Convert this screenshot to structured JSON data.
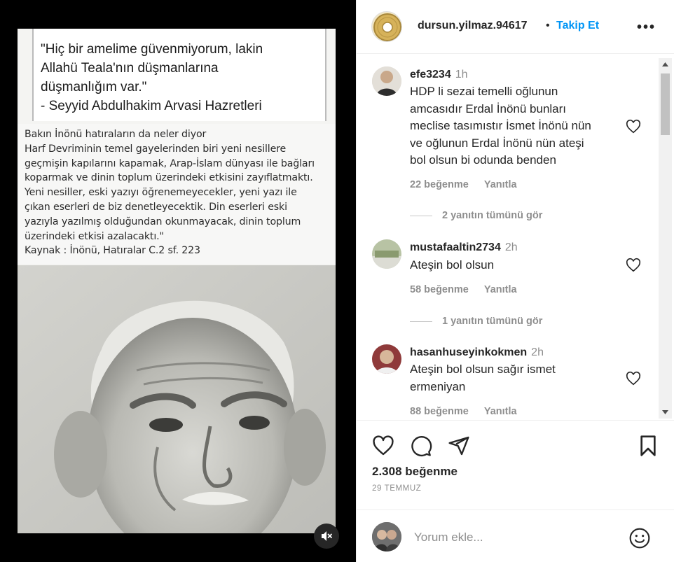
{
  "post": {
    "quote_lines": [
      "\"Hiç bir amelime güvenmiyorum, lakin",
      "Allahü Teala'nın düşmanlarına",
      "düşmanlığım var.\"",
      "- Seyyid Abdulhakim Arvasi Hazretleri"
    ],
    "text_lines": [
      "Bakın  İnönü hatıraların da neler diyor",
      "Harf Devriminin temel gayelerinden biri yeni nesillere",
      "geçmişin kapılarını kapamak, Arap-İslam dünyası ile bağları",
      "koparmak ve dinin toplum üzerindeki etkisini zayıflatmaktı.",
      "Yeni nesiller, eski yazıyı öğrenemeyecekler, yeni yazı ile",
      "çıkan eserleri de biz denetleyecektik. Din eserleri eski",
      "yazıyla yazılmış olduğundan okunmayacak, dinin toplum",
      "üzerindeki etkisi azalacaktı.\"",
      "Kaynak : İnönü, Hatıralar C.2 sf. 223"
    ],
    "mute_icon": "speaker-muted-icon"
  },
  "header": {
    "username": "dursun.yilmaz.94617",
    "dot": "•",
    "follow_label": "Takip Et",
    "more_label": "•••"
  },
  "comments": [
    {
      "username": "efe3234",
      "time": "1h",
      "text_lines": [
        "HDP li sezai temelli oğlunun",
        "amcasıdır Erdal İnönü bunları",
        "meclise tasımıstır İsmet İnönü nün",
        "ve oğlunun Erdal İnönü nün ateşi",
        "bol olsun bi odunda benden"
      ],
      "likes": "22 beğenme",
      "reply_label": "Yanıtla",
      "view_replies": "2 yanıtın tümünü gör"
    },
    {
      "username": "mustafaaltin2734",
      "time": "2h",
      "text_lines": [
        "Ateşin bol olsun"
      ],
      "likes": "58 beğenme",
      "reply_label": "Yanıtla",
      "view_replies": "1 yanıtın tümünü gör"
    },
    {
      "username": "hasanhuseyinkokmen",
      "time": "2h",
      "text_lines": [
        "Ateşin bol olsun sağır ismet",
        "ermeniyan"
      ],
      "likes": "88 beğenme",
      "reply_label": "Yanıtla"
    }
  ],
  "footer": {
    "likes": "2.308 beğenme",
    "date": "29 TEMMUZ",
    "comment_placeholder": "Yorum ekle..."
  },
  "colors": {
    "accent": "#0095f6",
    "muted_text": "#8e8e8e",
    "text": "#262626"
  }
}
